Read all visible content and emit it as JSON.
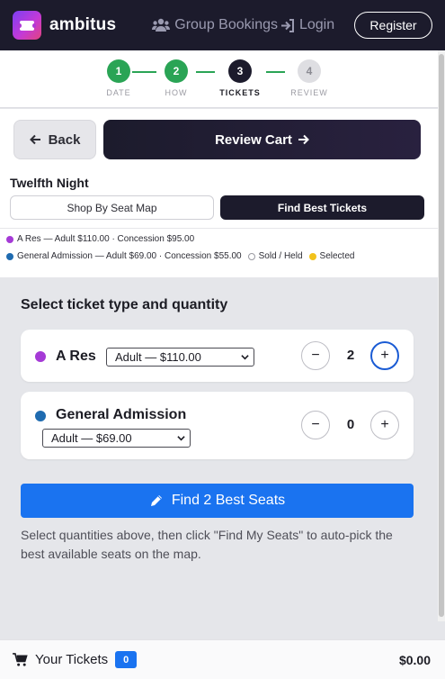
{
  "header": {
    "brand": "ambitus",
    "group_bookings": "Group Bookings",
    "login": "Login",
    "register": "Register"
  },
  "steps": [
    {
      "number": "1",
      "label": "DATE",
      "state": "done"
    },
    {
      "number": "2",
      "label": "HOW",
      "state": "done"
    },
    {
      "number": "3",
      "label": "TICKETS",
      "state": "active"
    },
    {
      "number": "4",
      "label": "REVIEW",
      "state": "pending"
    }
  ],
  "actions": {
    "back": "Back",
    "review_cart": "Review Cart"
  },
  "show": {
    "title": "Twelfth Night",
    "tab_map": "Shop By Seat Map",
    "tab_best": "Find Best Tickets"
  },
  "legend": {
    "a_res": "A Res — Adult $110.00 · Concession $95.00",
    "general": "General Admission — Adult $69.00 · Concession $55.00",
    "sold": "Sold / Held",
    "selected": "Selected"
  },
  "main": {
    "title": "Select ticket type and quantity",
    "tickets": [
      {
        "name": "A Res",
        "option": "Adult — $110.00",
        "quantity": "2",
        "minus": "−",
        "plus": "+"
      },
      {
        "name": "General Admission",
        "option": "Adult — $69.00",
        "quantity": "0",
        "minus": "−",
        "plus": "+"
      }
    ],
    "find_button": "Find 2 Best Seats",
    "helper": "Select quantities above, then click \"Find My Seats\" to auto-pick the best available seats on the map."
  },
  "footer": {
    "label": "Your Tickets",
    "count": "0",
    "total": "$0.00"
  },
  "colors": {
    "a_res": "#a53ad6",
    "general": "#1f6bb0",
    "selected": "#f2c21b",
    "success": "#2aa455",
    "primary": "#1a73f0",
    "dark": "#1c1b2c"
  },
  "icons": [
    "ticket-logo-icon",
    "users-icon",
    "login-icon",
    "arrow-left-icon",
    "arrow-right-icon",
    "pencil-icon",
    "cart-icon",
    "chevron-down-icon"
  ]
}
